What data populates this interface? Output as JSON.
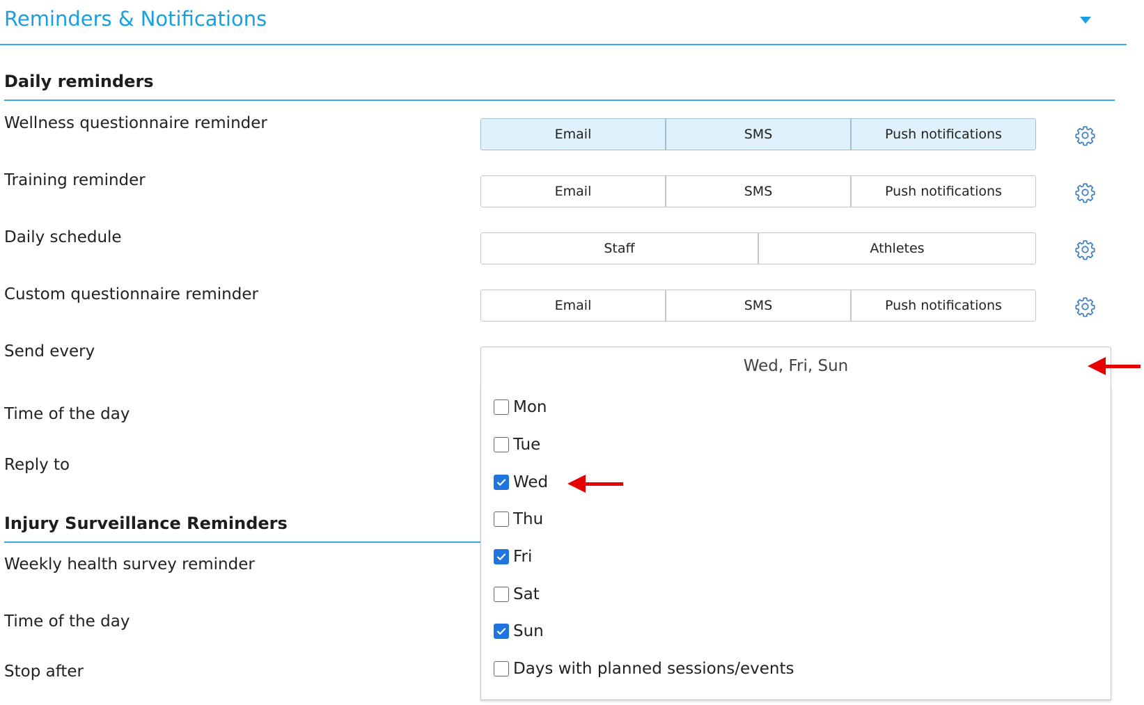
{
  "panel": {
    "title": "Reminders & Notifications"
  },
  "daily": {
    "title": "Daily reminders",
    "wellness": {
      "label": "Wellness questionnaire reminder",
      "options": [
        "Email",
        "SMS",
        "Push notifications"
      ]
    },
    "training": {
      "label": "Training reminder",
      "options": [
        "Email",
        "SMS",
        "Push notifications"
      ]
    },
    "schedule": {
      "label": "Daily schedule",
      "options": [
        "Staff",
        "Athletes"
      ]
    },
    "custom": {
      "label": "Custom questionnaire reminder",
      "options": [
        "Email",
        "SMS",
        "Push notifications"
      ]
    },
    "send_every": {
      "label": "Send every",
      "value": "Wed, Fri, Sun"
    },
    "time_of_day": {
      "label": "Time of the day"
    },
    "reply_to": {
      "label": "Reply to"
    }
  },
  "days": [
    {
      "label": "Mon",
      "checked": false
    },
    {
      "label": "Tue",
      "checked": false
    },
    {
      "label": "Wed",
      "checked": true
    },
    {
      "label": "Thu",
      "checked": false
    },
    {
      "label": "Fri",
      "checked": true
    },
    {
      "label": "Sat",
      "checked": false
    },
    {
      "label": "Sun",
      "checked": true
    },
    {
      "label": "Days with planned sessions/events",
      "checked": false
    }
  ],
  "injury": {
    "title": "Injury Surveillance Reminders",
    "weekly": {
      "label": "Weekly health survey reminder"
    },
    "time_of_day": {
      "label": "Time of the day"
    },
    "stop_after": {
      "label": "Stop after"
    }
  },
  "colors": {
    "accent": "#1a9fe0",
    "active_bg": "#dff1fb",
    "check": "#1f74e0",
    "annotation": "#e60000"
  }
}
